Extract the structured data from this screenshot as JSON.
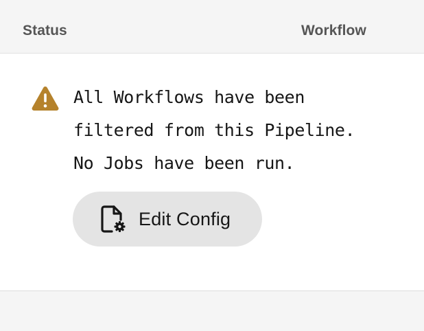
{
  "header": {
    "status_label": "Status",
    "workflow_label": "Workflow"
  },
  "message": {
    "lines": [
      "All Workflows have been",
      "filtered from this Pipeline.",
      "No Jobs have been run."
    ],
    "icon": "warning-triangle-icon",
    "icon_color": "#b5822c"
  },
  "action": {
    "label": "Edit Config",
    "icon": "file-settings-icon"
  }
}
